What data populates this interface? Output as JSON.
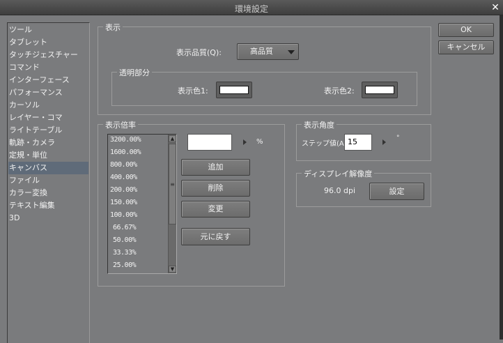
{
  "window": {
    "title": "環境設定",
    "close_icon": "close-icon"
  },
  "sidebar": {
    "items": [
      "ツール",
      "タブレット",
      "タッチジェスチャー",
      "コマンド",
      "インターフェース",
      "パフォーマンス",
      "カーソル",
      "レイヤー・コマ",
      "ライトテーブル",
      "軌跡・カメラ",
      "定規・単位",
      "キャンバス",
      "ファイル",
      "カラー変換",
      "テキスト編集",
      "3D"
    ],
    "selected": "キャンバス"
  },
  "display": {
    "title": "表示",
    "quality_label": "表示品質(Q):",
    "quality_value": "高品質",
    "transparent": {
      "title": "透明部分",
      "color1_label": "表示色1:",
      "color2_label": "表示色2:",
      "color1": "#ffffff",
      "color2": "#ffffff"
    }
  },
  "zoom": {
    "title": "表示倍率",
    "list": [
      "3200.00%",
      "1600.00%",
      "800.00%",
      "400.00%",
      "200.00%",
      "150.00%",
      "100.00%",
      "66.67%",
      "50.00%",
      "33.33%",
      "25.00%"
    ],
    "input_value": "",
    "unit": "%",
    "add": "追加",
    "delete": "削除",
    "change": "変更",
    "reset": "元に戻す"
  },
  "angle": {
    "title": "表示角度",
    "step_label": "ステップ値(A):",
    "step_value": "15",
    "unit": "°"
  },
  "resolution": {
    "title": "ディスプレイ解像度",
    "value": "96.0 dpi",
    "set_button": "設定"
  },
  "buttons": {
    "ok": "OK",
    "cancel": "キャンセル"
  }
}
